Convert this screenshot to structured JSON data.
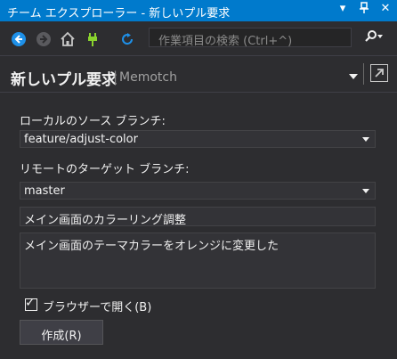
{
  "window": {
    "title": "チーム エクスプローラー - 新しいプル要求",
    "icons": [
      "chevron-down-icon",
      "pin-icon",
      "close-icon"
    ]
  },
  "toolbar": {
    "icons": [
      "back-icon",
      "forward-icon",
      "home-icon",
      "connect-icon",
      "refresh-icon"
    ],
    "search_placeholder": "作業項目の検索 (Ctrl+^)",
    "search_icon": "search-icon"
  },
  "header": {
    "title": "新しいプル要求",
    "separator": "|",
    "project": "Memotch"
  },
  "form": {
    "source_label": "ローカルのソース ブランチ:",
    "source_value": "feature/adjust-color",
    "target_label": "リモートのターゲット ブランチ:",
    "target_value": "master",
    "title_value": "メイン画面のカラーリング調整",
    "description_value": "メイン画面のテーマカラーをオレンジに変更した",
    "open_browser_label": "ブラウザーで開く(B)",
    "open_browser_checked": true,
    "create_label": "作成(R)"
  },
  "colors": {
    "accent": "#007acc",
    "background": "#2d2d30",
    "control": "#333337",
    "home_icon": "#c8c8c8",
    "connect_icon": "#8ad32e",
    "nav_icon": "#1e90e8"
  }
}
